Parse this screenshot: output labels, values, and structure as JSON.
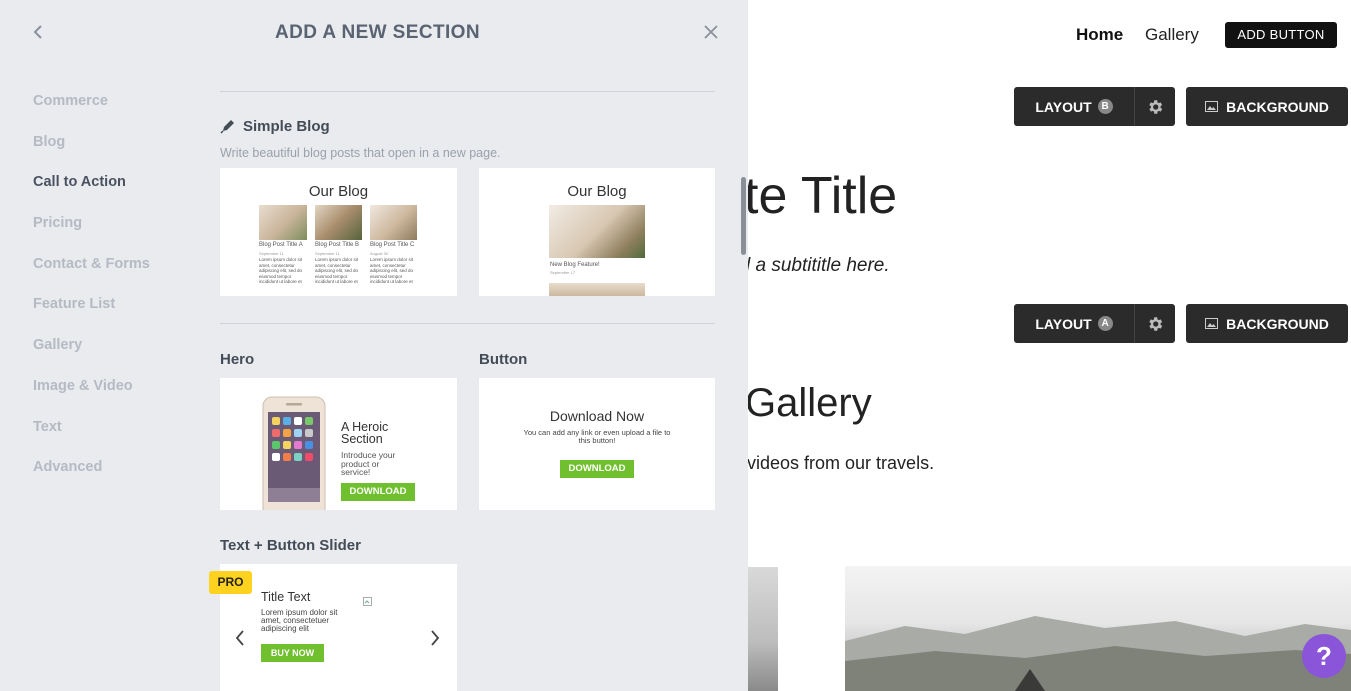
{
  "panel": {
    "title": "ADD A NEW SECTION",
    "categories": [
      {
        "label": "Commerce"
      },
      {
        "label": "Blog"
      },
      {
        "label": "Call to Action"
      },
      {
        "label": "Pricing"
      },
      {
        "label": "Contact & Forms"
      },
      {
        "label": "Feature List"
      },
      {
        "label": "Gallery"
      },
      {
        "label": "Image & Video"
      },
      {
        "label": "Text"
      },
      {
        "label": "Advanced"
      }
    ],
    "simple_blog": {
      "label": "Simple Blog",
      "description": "Write beautiful blog posts that open in a new page.",
      "card1": {
        "title": "Our Blog",
        "posts": [
          {
            "title": "Blog Post Title A",
            "date": "September 11",
            "body": "Lorem ipsum dolor sit amet, consectetur adipiscing elit, sed do eiusmod tempor incididunt ut labore et dolore magna aliqua."
          },
          {
            "title": "Blog Post Title B",
            "date": "September 11",
            "body": "Lorem ipsum dolor sit amet, consectetur adipiscing elit, sed do eiusmod tempor incididunt ut labore et dolore magna aliqua."
          },
          {
            "title": "Blog Post Title C",
            "date": "August 30",
            "body": "Lorem ipsum dolor sit amet, consectetur adipiscing elit, sed do eiusmod tempor incididunt ut labore et dolore magna aliqua."
          }
        ]
      },
      "card2": {
        "title": "Our Blog",
        "post_title": "New Blog Feature!",
        "post_date": "September 17"
      }
    },
    "hero": {
      "label": "Hero",
      "heading": "A Heroic Section",
      "text": "Introduce your product or service!",
      "button": "DOWNLOAD"
    },
    "button_section": {
      "label": "Button",
      "heading": "Download Now",
      "text": "You can add any link or even upload a file to this button!",
      "button": "DOWNLOAD"
    },
    "slider": {
      "label": "Text + Button Slider",
      "badge": "PRO",
      "title": "Title Text",
      "text": "Lorem ipsum dolor sit amet, consectetuer adipiscing elit",
      "button": "BUY NOW"
    }
  },
  "site": {
    "nav": {
      "home": "Home",
      "gallery": "Gallery",
      "add_button": "ADD BUTTON"
    },
    "controls": [
      {
        "layout_label": "LAYOUT",
        "layout_badge": "B",
        "background_label": "BACKGROUND"
      },
      {
        "layout_label": "LAYOUT",
        "layout_badge": "A",
        "background_label": "BACKGROUND"
      }
    ],
    "title_visible": "te Title",
    "subtitle_visible": "l a subtititle here.",
    "gallery_title_visible": "Gallery",
    "gallery_text_visible": "videos from our travels.",
    "help_label": "?"
  },
  "colors": {
    "panel_bg": "#e9ebef",
    "accent_green": "#6fbf2e",
    "pro_yellow": "#ffd21f",
    "help_purple": "#8a55d8",
    "control_dark": "#2b2b2b"
  }
}
